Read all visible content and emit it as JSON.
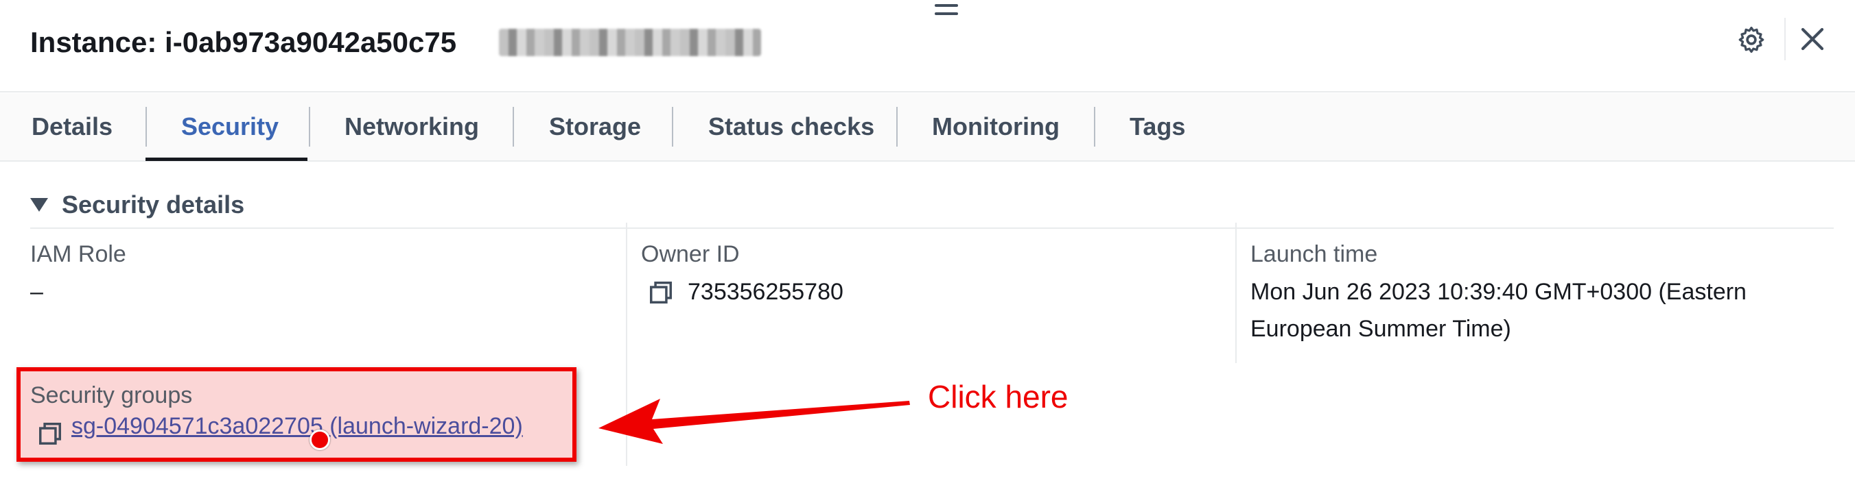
{
  "header": {
    "title": "Instance: i-0ab973a9042a50c75",
    "settings_icon": "gear-icon",
    "close_icon": "close-icon"
  },
  "tabs": [
    {
      "label": "Details"
    },
    {
      "label": "Security",
      "active": true
    },
    {
      "label": "Networking"
    },
    {
      "label": "Storage"
    },
    {
      "label": "Status checks"
    },
    {
      "label": "Monitoring"
    },
    {
      "label": "Tags"
    }
  ],
  "security_details": {
    "heading": "Security details",
    "iam_role": {
      "label": "IAM Role",
      "value": "–"
    },
    "owner_id": {
      "label": "Owner ID",
      "value": "735356255780"
    },
    "launch_time": {
      "label": "Launch time",
      "line1": "Mon Jun 26 2023 10:39:40 GMT+0300 (Eastern",
      "line2": "European Summer Time)"
    },
    "security_groups": {
      "label": "Security groups",
      "link": "sg-04904571c3a022705 (launch-wizard-20)"
    }
  },
  "annotation": {
    "text": "Click here",
    "color": "#ee0000"
  },
  "colors": {
    "active_tab": "#3b66b4",
    "link": "#4a4d9c",
    "highlight_fill": "#fbd6d6"
  }
}
